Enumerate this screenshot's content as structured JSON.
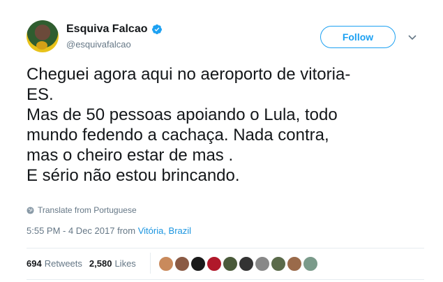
{
  "user": {
    "name": "Esquiva Falcao",
    "handle": "@esquivafalcao",
    "follow_label": "Follow"
  },
  "tweet": {
    "text": "Cheguei agora aqui no aeroporto de vitoria-\nES.\nMas de 50 pessoas apoiando o Lula, todo\nmundo fedendo a cachaça. Nada contra,\nmas o cheiro estar de mas .\nE sério não estou brincando.",
    "translate_label": "Translate from Portuguese",
    "timestamp": "5:55 PM - 4 Dec 2017",
    "from_label": "from",
    "location": "Vitória, Brazil"
  },
  "stats": {
    "retweets_count": "694",
    "retweets_label": "Retweets",
    "likes_count": "2,580",
    "likes_label": "Likes"
  },
  "colors": {
    "accent": "#1da1f2",
    "link": "#1b95e0",
    "muted": "#657786"
  },
  "liker_faces": [
    "#c98a5c",
    "#8a5a44",
    "#1a1a1a",
    "#b0182a",
    "#4a5a3a",
    "#333333",
    "#888888",
    "#5a6a4a",
    "#9a6a4a",
    "#7a9a8a"
  ]
}
